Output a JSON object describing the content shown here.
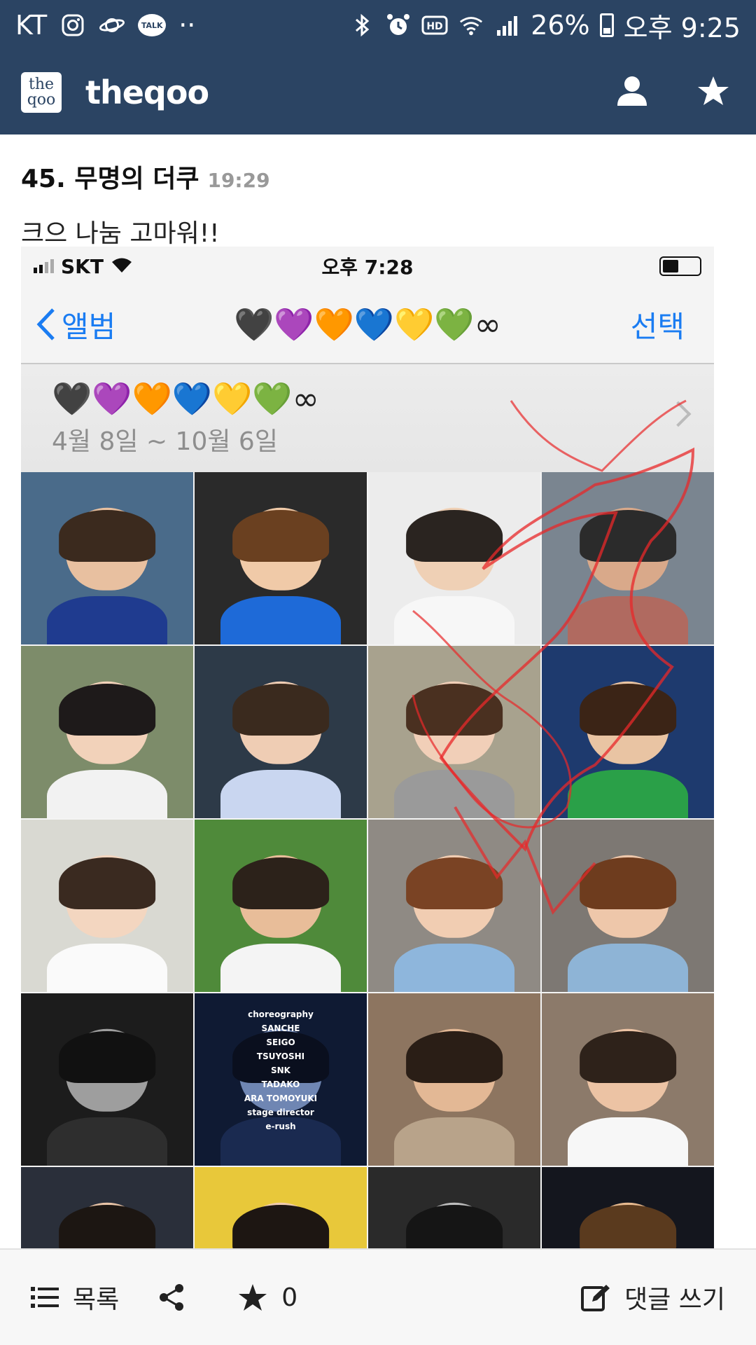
{
  "status_bar": {
    "carrier": "KT",
    "dots": "··",
    "talk_badge": "TALK",
    "battery": "26%",
    "time": "오후 9:25",
    "icons": [
      "instagram-icon",
      "planet-icon",
      "kakaotalk-icon",
      "bluetooth-icon",
      "alarm-icon",
      "hd-icon",
      "wifi-icon",
      "signal-icon",
      "battery-icon"
    ]
  },
  "app_bar": {
    "logo_top": "the",
    "logo_bottom": "qoo",
    "title": "theqoo",
    "icons": [
      "profile-icon",
      "star-icon"
    ],
    "color": "#2b4463"
  },
  "comment": {
    "number": "45.",
    "author": "무명의 더쿠",
    "time": "19:29",
    "text": "크으 나눔 고마워!!"
  },
  "embedded_screenshot": {
    "status": {
      "carrier": "SKT",
      "time": "오후 7:28"
    },
    "nav": {
      "back_label": "앨범",
      "title": "🖤💜🧡💙💛💚∞",
      "select_label": "선택",
      "accent": "#1a7cf2"
    },
    "album": {
      "name": "🖤💜🧡💙💛💚∞",
      "dates": "4월 8일 ~ 10월 6일"
    },
    "photo_credits_text": [
      "choreography",
      "SANCHE",
      "SEIGO",
      "TSUYOSHI",
      "SNK",
      "TADAKO",
      "ARA TOMOYUKI",
      "stage director",
      "e-rush"
    ],
    "photos": [
      {
        "bg": "#4a6b8a",
        "skin": "#e8c0a0",
        "hair": "#3b2a1e",
        "cloth": "#1f3b8f"
      },
      {
        "bg": "#2a2a2a",
        "skin": "#f0caa8",
        "hair": "#6a4020",
        "cloth": "#1e6ad8"
      },
      {
        "bg": "#ececec",
        "skin": "#efd0b5",
        "hair": "#2a2420",
        "cloth": "#f7f7f7"
      },
      {
        "bg": "#7a8590",
        "skin": "#d9a98a",
        "hair": "#2b2b2b",
        "cloth": "#b06a60"
      },
      {
        "bg": "#7d8c6a",
        "skin": "#f2d2ba",
        "hair": "#1e1a1a",
        "cloth": "#f2f2f2"
      },
      {
        "bg": "#2d3a48",
        "skin": "#efcdb4",
        "hair": "#3a2a1e",
        "cloth": "#c9d6f0"
      },
      {
        "bg": "#a8a28e",
        "skin": "#f1cfb8",
        "hair": "#4a3020",
        "cloth": "#9a9a9a"
      },
      {
        "bg": "#1e3a6e",
        "skin": "#e9c4a3",
        "hair": "#3b2416",
        "cloth": "#2aa048"
      },
      {
        "bg": "#d9d9d2",
        "skin": "#f3d6c0",
        "hair": "#3a2a20",
        "cloth": "#fafafa"
      },
      {
        "bg": "#4f8a3a",
        "skin": "#e8bd99",
        "hair": "#2c221a",
        "cloth": "#f4f4f4"
      },
      {
        "bg": "#8f8a84",
        "skin": "#f1cdb2",
        "hair": "#7a4324",
        "cloth": "#8eb6dc"
      },
      {
        "bg": "#7d7873",
        "skin": "#eec7aa",
        "hair": "#6e3c1e",
        "cloth": "#8eb4d6"
      },
      {
        "bg": "#1c1c1c",
        "skin": "#9e9e9e",
        "hair": "#111111",
        "cloth": "#2e2e2e"
      },
      {
        "bg": "#0f1a33",
        "skin": "#6f86b3",
        "hair": "#0a0f1e",
        "cloth": "#1a2a50"
      },
      {
        "bg": "#8d7560",
        "skin": "#e3b895",
        "hair": "#2a1e16",
        "cloth": "#b8a38a"
      },
      {
        "bg": "#8c7a6a",
        "skin": "#ecc3a4",
        "hair": "#2e221a",
        "cloth": "#f7f7f7"
      },
      {
        "bg": "#2a2f3a",
        "skin": "#e7c3a6",
        "hair": "#1c1612",
        "cloth": "#3a4a6a"
      },
      {
        "bg": "#e8c83a",
        "skin": "#f0ccae",
        "hair": "#1d1612",
        "cloth": "#5a4030"
      },
      {
        "bg": "#2a2a2a",
        "skin": "#bdbdbd",
        "hair": "#151515",
        "cloth": "#3a3a3a"
      },
      {
        "bg": "#14161e",
        "skin": "#e6b98f",
        "hair": "#5a3a1e",
        "cloth": "#1e1e28"
      }
    ]
  },
  "bottom_bar": {
    "list_label": "목록",
    "star_count": "0",
    "write_label": "댓글 쓰기"
  }
}
